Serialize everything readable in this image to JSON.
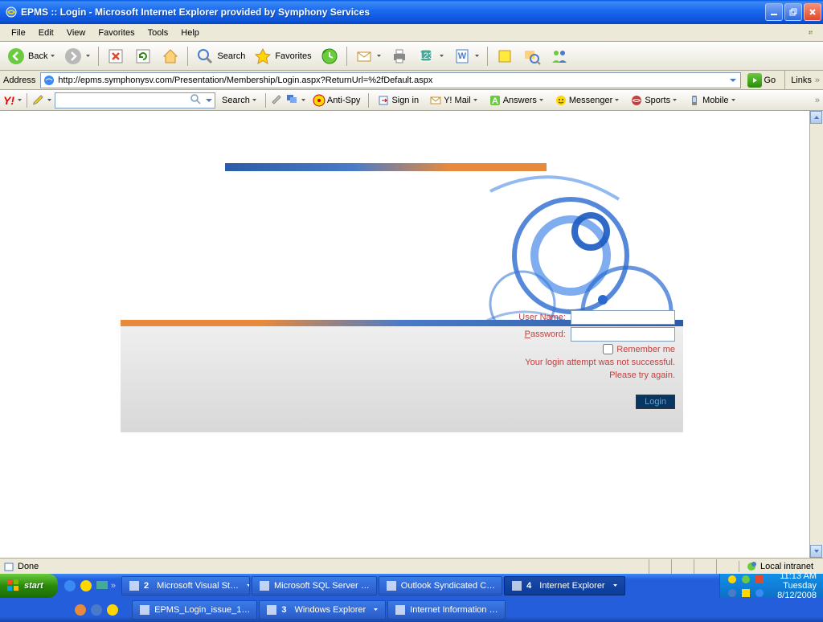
{
  "window_title": "EPMS :: Login - Microsoft Internet Explorer provided by Symphony Services",
  "menu": {
    "file": "File",
    "edit": "Edit",
    "view": "View",
    "favorites": "Favorites",
    "tools": "Tools",
    "help": "Help"
  },
  "toolbar": {
    "back": "Back",
    "search": "Search",
    "favorites": "Favorites"
  },
  "address": {
    "label": "Address",
    "url": "http://epms.symphonysv.com/Presentation/Membership/Login.aspx?ReturnUrl=%2fDefault.aspx",
    "go": "Go",
    "links": "Links"
  },
  "yahoo": {
    "search": "Search",
    "antispy": "Anti-Spy",
    "signin": "Sign in",
    "mail": "Y! Mail",
    "answers": "Answers",
    "messenger": "Messenger",
    "sports": "Sports",
    "mobile": "Mobile"
  },
  "login": {
    "username_label": "ser Name:",
    "password_label": "assword:",
    "remember": "emember me",
    "error1": "Your login attempt was not successful.",
    "error2": "Please try again.",
    "button": "Login"
  },
  "status": {
    "done": "Done",
    "zone": "Local intranet"
  },
  "taskbar": {
    "start": "start",
    "row1": [
      {
        "label": "2 Microsoft Visual St…",
        "count": "2"
      },
      {
        "label": "Microsoft SQL Server …"
      },
      {
        "label": "Outlook Syndicated C…"
      },
      {
        "label": "4 Internet Explorer",
        "count": "4",
        "active": true
      }
    ],
    "row2": [
      {
        "label": "EPMS_Login_issue_1…"
      },
      {
        "label": "3 Windows Explorer",
        "count": "3"
      },
      {
        "label": "Internet Information …"
      }
    ],
    "time": "11:13 AM",
    "day": "Tuesday",
    "date": "8/12/2008"
  }
}
